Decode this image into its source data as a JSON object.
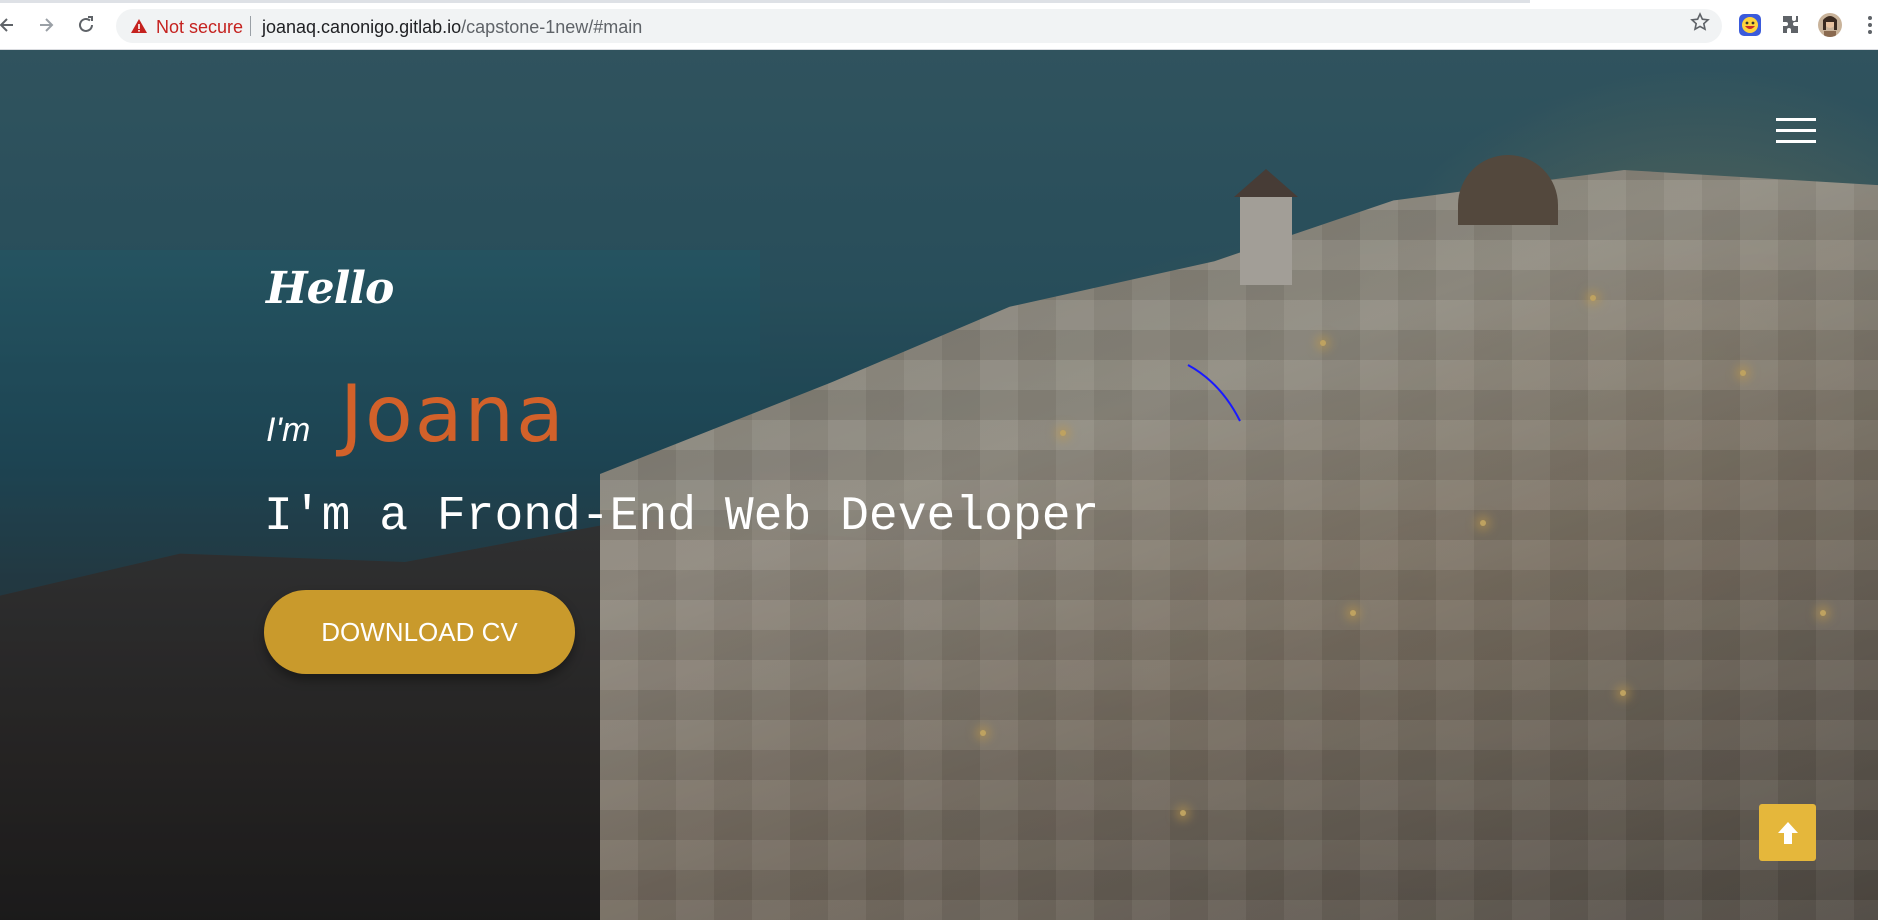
{
  "browser": {
    "security_label": "Not secure",
    "url_host": "joanaq.canonigo.gitlab.io",
    "url_path": "/capstone-1new/#main",
    "icons": [
      "back-arrow-icon",
      "forward-arrow-icon",
      "reload-icon",
      "warning-icon",
      "bookmark-star-icon",
      "emoji-extension-icon",
      "puzzle-extensions-icon",
      "profile-avatar",
      "kebab-menu-icon"
    ]
  },
  "hero": {
    "greeting": "Hello",
    "im_prefix": "I'm",
    "name": "Joana",
    "role": "I'm a Frond-End Web Developer",
    "cv_button": "DOWNLOAD CV",
    "menu_icon": "hamburger-menu-icon",
    "scroll_top_icon": "arrow-up-icon",
    "colors": {
      "name": "#d2612a",
      "cv_button": "#c99a2c",
      "scroll_top": "#e5b73b"
    }
  }
}
